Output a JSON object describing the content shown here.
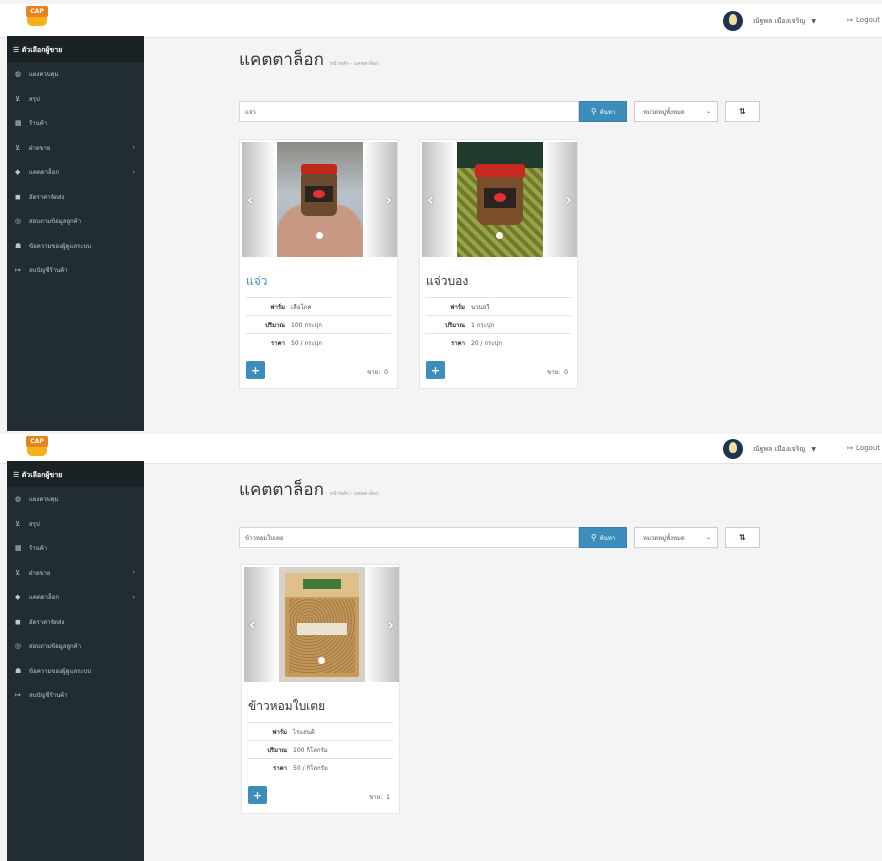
{
  "screens": [
    {
      "topbar": {
        "logo_text": "CAP",
        "user_name": "ณัฐพล เมืองเจริญ",
        "logout_label": "Logout"
      },
      "sidebar": {
        "header": "ตัวเลือกผู้ขาย",
        "items": [
          {
            "label": "แผงควบคุม",
            "icon": "dashboard-icon"
          },
          {
            "label": "สรุป",
            "icon": "cart-icon"
          },
          {
            "label": "ร้านค้า",
            "icon": "store-icon"
          },
          {
            "label": "ฝ่ายขาย",
            "icon": "cart-icon"
          },
          {
            "label": "แคตตาล็อก",
            "icon": "tag-icon"
          },
          {
            "label": "อัตราค่าจัดส่ง",
            "icon": "truck-icon"
          },
          {
            "label": "สอบถามข้อมูลลูกค้า",
            "icon": "support-icon"
          },
          {
            "label": "ข้อความของผู้ดูแลระบบ",
            "icon": "users-icon"
          },
          {
            "label": "ลบบัญชีร้านค้า",
            "icon": "sign-out-icon"
          }
        ]
      },
      "page": {
        "title": "แคตตาล็อก",
        "breadcrumb": "หน้าหลัก › แคตตาล็อก"
      },
      "search": {
        "value": "แจ่ว",
        "button_label": "ค้นหา"
      },
      "category_select": {
        "selected": "หมวดหมู่ทั้งหมด"
      },
      "products": [
        {
          "name": "แจ่ว",
          "rows": [
            {
              "label": "ฟาร์ม",
              "value": "เลือโภค"
            },
            {
              "label": "ปริมาณ",
              "value": "100 กระปุก"
            },
            {
              "label": "ราคา",
              "value": "50 / กระปุก"
            }
          ],
          "sold_label": "ขาย:",
          "sold": "0"
        },
        {
          "name": "แจ่วบอง",
          "rows": [
            {
              "label": "ฟาร์ม",
              "value": "นวนอวี"
            },
            {
              "label": "ปริมาณ",
              "value": "1 กระปุก"
            },
            {
              "label": "ราคา",
              "value": "20 / กระปุก"
            }
          ],
          "sold_label": "ขาย:",
          "sold": "0"
        }
      ]
    },
    {
      "topbar": {
        "logo_text": "CAP",
        "user_name": "ณัฐพล เมืองเจริญ",
        "logout_label": "Logout"
      },
      "sidebar": {
        "header": "ตัวเลือกผู้ขาย",
        "items": [
          {
            "label": "แผงควบคุม",
            "icon": "dashboard-icon"
          },
          {
            "label": "สรุป",
            "icon": "cart-icon"
          },
          {
            "label": "ร้านค้า",
            "icon": "store-icon"
          },
          {
            "label": "ฝ่ายขาย",
            "icon": "cart-icon"
          },
          {
            "label": "แคตตาล็อก",
            "icon": "tag-icon"
          },
          {
            "label": "อัตราค่าจัดส่ง",
            "icon": "truck-icon"
          },
          {
            "label": "สอบถามข้อมูลลูกค้า",
            "icon": "support-icon"
          },
          {
            "label": "ข้อความของผู้ดูแลระบบ",
            "icon": "users-icon"
          },
          {
            "label": "ลบบัญชีร้านค้า",
            "icon": "sign-out-icon"
          }
        ]
      },
      "page": {
        "title": "แคตตาล็อก",
        "breadcrumb": "หน้าหลัก › แคตตาล็อก"
      },
      "search": {
        "value": "ข้าวหอมใบเตย",
        "button_label": "ค้นหา"
      },
      "category_select": {
        "selected": "หมวดหมู่ทั้งหมด"
      },
      "products": [
        {
          "name": "ข้าวหอมใบเตย",
          "rows": [
            {
              "label": "ฟาร์ม",
              "value": "ไร่แสนดี"
            },
            {
              "label": "ปริมาณ",
              "value": "100 กิโลกรัม"
            },
            {
              "label": "ราคา",
              "value": "50 / กิโลกรัม"
            }
          ],
          "sold_label": "ขาย:",
          "sold": "1"
        }
      ]
    }
  ],
  "colors": {
    "sidebar_bg": "#222d32",
    "primary": "#3c8dbc",
    "page_bg": "#f4f4f4"
  }
}
